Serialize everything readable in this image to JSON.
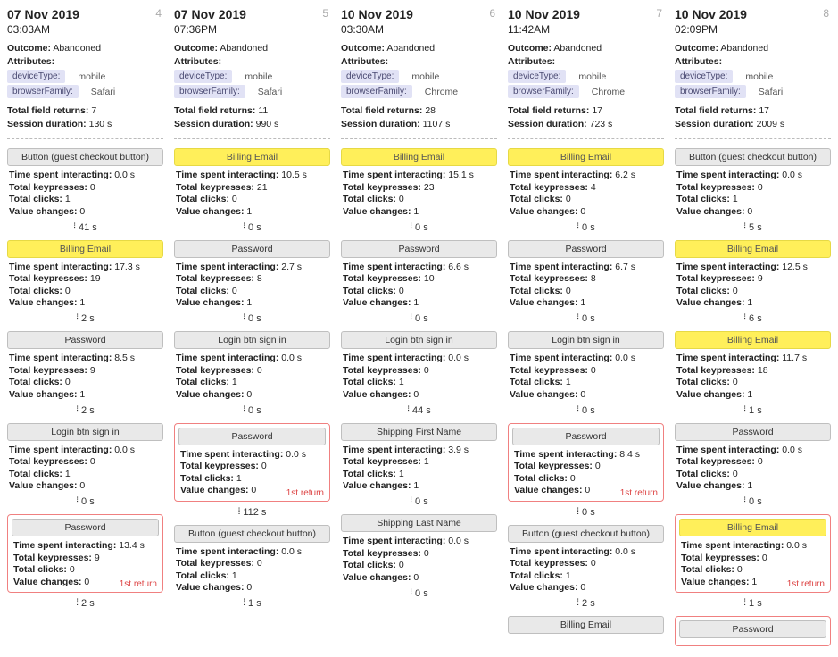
{
  "labels": {
    "outcome": "Outcome:",
    "attributes": "Attributes:",
    "deviceType": "deviceType:",
    "browserFamily": "browserFamily:",
    "fieldReturns": "Total field returns:",
    "sessionDuration": "Session duration:",
    "tsi": "Time spent interacting:",
    "tkp": "Total keypresses:",
    "tcl": "Total clicks:",
    "tvc": "Value changes:"
  },
  "columns": [
    {
      "num": "4",
      "date": "07 Nov 2019",
      "time": "03:03AM",
      "outcome": "Abandoned",
      "device": "mobile",
      "browser": "Safari",
      "fieldReturns": "7",
      "duration": "130 s",
      "steps": [
        {
          "name": "Button (guest checkout button)",
          "highlight": false,
          "tsi": "0.0 s",
          "tkp": "0",
          "tcl": "1",
          "tvc": "0",
          "gap": "41 s"
        },
        {
          "name": "Billing Email",
          "highlight": true,
          "tsi": "17.3 s",
          "tkp": "19",
          "tcl": "0",
          "tvc": "1",
          "gap": "2 s"
        },
        {
          "name": "Password",
          "highlight": false,
          "tsi": "8.5 s",
          "tkp": "9",
          "tcl": "0",
          "tvc": "1",
          "gap": "2 s"
        },
        {
          "name": "Login btn sign in",
          "highlight": false,
          "tsi": "0.0 s",
          "tkp": "0",
          "tcl": "1",
          "tvc": "0",
          "gap": "0 s"
        },
        {
          "name": "Password",
          "highlight": false,
          "return": "1st return",
          "tsi": "13.4 s",
          "tkp": "9",
          "tcl": "0",
          "tvc": "0",
          "gap": "2 s"
        }
      ]
    },
    {
      "num": "5",
      "date": "07 Nov 2019",
      "time": "07:36PM",
      "outcome": "Abandoned",
      "device": "mobile",
      "browser": "Safari",
      "fieldReturns": "11",
      "duration": "990 s",
      "steps": [
        {
          "name": "Billing Email",
          "highlight": true,
          "tsi": "10.5 s",
          "tkp": "21",
          "tcl": "0",
          "tvc": "1",
          "gap": "0 s"
        },
        {
          "name": "Password",
          "highlight": false,
          "tsi": "2.7 s",
          "tkp": "8",
          "tcl": "0",
          "tvc": "1",
          "gap": "0 s"
        },
        {
          "name": "Login btn sign in",
          "highlight": false,
          "tsi": "0.0 s",
          "tkp": "0",
          "tcl": "1",
          "tvc": "0",
          "gap": "0 s"
        },
        {
          "name": "Password",
          "highlight": false,
          "return": "1st return",
          "tsi": "0.0 s",
          "tkp": "0",
          "tcl": "1",
          "tvc": "0",
          "gap": "112 s"
        },
        {
          "name": "Button (guest checkout button)",
          "highlight": false,
          "tsi": "0.0 s",
          "tkp": "0",
          "tcl": "1",
          "tvc": "0",
          "gap": "1 s"
        }
      ]
    },
    {
      "num": "6",
      "date": "10 Nov 2019",
      "time": "03:30AM",
      "outcome": "Abandoned",
      "device": "mobile",
      "browser": "Chrome",
      "fieldReturns": "28",
      "duration": "1107 s",
      "steps": [
        {
          "name": "Billing Email",
          "highlight": true,
          "tsi": "15.1 s",
          "tkp": "23",
          "tcl": "0",
          "tvc": "1",
          "gap": "0 s"
        },
        {
          "name": "Password",
          "highlight": false,
          "tsi": "6.6 s",
          "tkp": "10",
          "tcl": "0",
          "tvc": "1",
          "gap": "0 s"
        },
        {
          "name": "Login btn sign in",
          "highlight": false,
          "tsi": "0.0 s",
          "tkp": "0",
          "tcl": "1",
          "tvc": "0",
          "gap": "44 s"
        },
        {
          "name": "Shipping First Name",
          "highlight": false,
          "tsi": "3.9 s",
          "tkp": "1",
          "tcl": "1",
          "tvc": "1",
          "gap": "0 s"
        },
        {
          "name": "Shipping Last Name",
          "highlight": false,
          "tsi": "0.0 s",
          "tkp": "0",
          "tcl": "0",
          "tvc": "0",
          "gap": "0 s"
        }
      ]
    },
    {
      "num": "7",
      "date": "10 Nov 2019",
      "time": "11:42AM",
      "outcome": "Abandoned",
      "device": "mobile",
      "browser": "Chrome",
      "fieldReturns": "17",
      "duration": "723 s",
      "steps": [
        {
          "name": "Billing Email",
          "highlight": true,
          "tsi": "6.2 s",
          "tkp": "4",
          "tcl": "0",
          "tvc": "0",
          "gap": "0 s"
        },
        {
          "name": "Password",
          "highlight": false,
          "tsi": "6.7 s",
          "tkp": "8",
          "tcl": "0",
          "tvc": "1",
          "gap": "0 s"
        },
        {
          "name": "Login btn sign in",
          "highlight": false,
          "tsi": "0.0 s",
          "tkp": "0",
          "tcl": "1",
          "tvc": "0",
          "gap": "0 s"
        },
        {
          "name": "Password",
          "highlight": false,
          "return": "1st return",
          "tsi": "8.4 s",
          "tkp": "0",
          "tcl": "0",
          "tvc": "0",
          "gap": "0 s"
        },
        {
          "name": "Button (guest checkout button)",
          "highlight": false,
          "tsi": "0.0 s",
          "tkp": "0",
          "tcl": "1",
          "tvc": "0",
          "gap": "2 s"
        },
        {
          "name": "Billing Email",
          "highlight": false,
          "partial": true
        }
      ]
    },
    {
      "num": "8",
      "date": "10 Nov 2019",
      "time": "02:09PM",
      "outcome": "Abandoned",
      "device": "mobile",
      "browser": "Safari",
      "fieldReturns": "17",
      "duration": "2009 s",
      "steps": [
        {
          "name": "Button (guest checkout button)",
          "highlight": false,
          "tsi": "0.0 s",
          "tkp": "0",
          "tcl": "1",
          "tvc": "0",
          "gap": "5 s"
        },
        {
          "name": "Billing Email",
          "highlight": true,
          "tsi": "12.5 s",
          "tkp": "9",
          "tcl": "0",
          "tvc": "1",
          "gap": "6 s"
        },
        {
          "name": "Billing Email",
          "highlight": true,
          "tsi": "11.7 s",
          "tkp": "18",
          "tcl": "0",
          "tvc": "1",
          "gap": "1 s"
        },
        {
          "name": "Password",
          "highlight": false,
          "tsi": "0.0 s",
          "tkp": "0",
          "tcl": "0",
          "tvc": "1",
          "gap": "0 s"
        },
        {
          "name": "Billing Email",
          "highlight": true,
          "return": "1st return",
          "tsi": "0.0 s",
          "tkp": "0",
          "tcl": "0",
          "tvc": "1",
          "gap": "1 s"
        },
        {
          "name": "Password",
          "highlight": false,
          "return": "",
          "partial": true
        }
      ]
    }
  ]
}
